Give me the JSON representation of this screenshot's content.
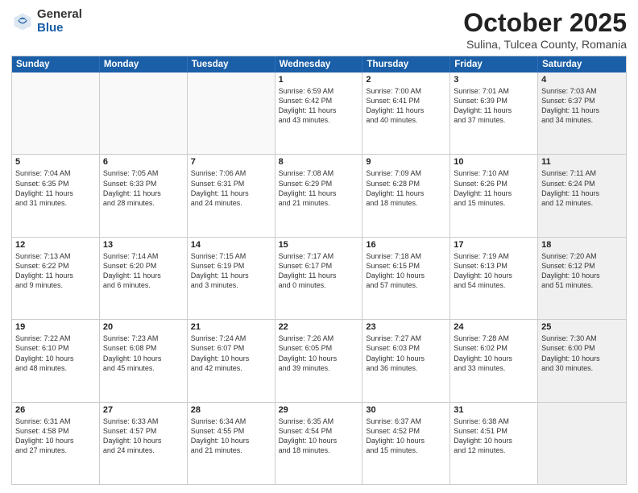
{
  "logo": {
    "general": "General",
    "blue": "Blue"
  },
  "title": {
    "month": "October 2025",
    "location": "Sulina, Tulcea County, Romania"
  },
  "header_days": [
    "Sunday",
    "Monday",
    "Tuesday",
    "Wednesday",
    "Thursday",
    "Friday",
    "Saturday"
  ],
  "rows": [
    [
      {
        "day": "",
        "lines": [],
        "empty": true
      },
      {
        "day": "",
        "lines": [],
        "empty": true
      },
      {
        "day": "",
        "lines": [],
        "empty": true
      },
      {
        "day": "1",
        "lines": [
          "Sunrise: 6:59 AM",
          "Sunset: 6:42 PM",
          "Daylight: 11 hours",
          "and 43 minutes."
        ],
        "empty": false
      },
      {
        "day": "2",
        "lines": [
          "Sunrise: 7:00 AM",
          "Sunset: 6:41 PM",
          "Daylight: 11 hours",
          "and 40 minutes."
        ],
        "empty": false
      },
      {
        "day": "3",
        "lines": [
          "Sunrise: 7:01 AM",
          "Sunset: 6:39 PM",
          "Daylight: 11 hours",
          "and 37 minutes."
        ],
        "empty": false
      },
      {
        "day": "4",
        "lines": [
          "Sunrise: 7:03 AM",
          "Sunset: 6:37 PM",
          "Daylight: 11 hours",
          "and 34 minutes."
        ],
        "empty": false,
        "shaded": true
      }
    ],
    [
      {
        "day": "5",
        "lines": [
          "Sunrise: 7:04 AM",
          "Sunset: 6:35 PM",
          "Daylight: 11 hours",
          "and 31 minutes."
        ],
        "empty": false
      },
      {
        "day": "6",
        "lines": [
          "Sunrise: 7:05 AM",
          "Sunset: 6:33 PM",
          "Daylight: 11 hours",
          "and 28 minutes."
        ],
        "empty": false
      },
      {
        "day": "7",
        "lines": [
          "Sunrise: 7:06 AM",
          "Sunset: 6:31 PM",
          "Daylight: 11 hours",
          "and 24 minutes."
        ],
        "empty": false
      },
      {
        "day": "8",
        "lines": [
          "Sunrise: 7:08 AM",
          "Sunset: 6:29 PM",
          "Daylight: 11 hours",
          "and 21 minutes."
        ],
        "empty": false
      },
      {
        "day": "9",
        "lines": [
          "Sunrise: 7:09 AM",
          "Sunset: 6:28 PM",
          "Daylight: 11 hours",
          "and 18 minutes."
        ],
        "empty": false
      },
      {
        "day": "10",
        "lines": [
          "Sunrise: 7:10 AM",
          "Sunset: 6:26 PM",
          "Daylight: 11 hours",
          "and 15 minutes."
        ],
        "empty": false
      },
      {
        "day": "11",
        "lines": [
          "Sunrise: 7:11 AM",
          "Sunset: 6:24 PM",
          "Daylight: 11 hours",
          "and 12 minutes."
        ],
        "empty": false,
        "shaded": true
      }
    ],
    [
      {
        "day": "12",
        "lines": [
          "Sunrise: 7:13 AM",
          "Sunset: 6:22 PM",
          "Daylight: 11 hours",
          "and 9 minutes."
        ],
        "empty": false
      },
      {
        "day": "13",
        "lines": [
          "Sunrise: 7:14 AM",
          "Sunset: 6:20 PM",
          "Daylight: 11 hours",
          "and 6 minutes."
        ],
        "empty": false
      },
      {
        "day": "14",
        "lines": [
          "Sunrise: 7:15 AM",
          "Sunset: 6:19 PM",
          "Daylight: 11 hours",
          "and 3 minutes."
        ],
        "empty": false
      },
      {
        "day": "15",
        "lines": [
          "Sunrise: 7:17 AM",
          "Sunset: 6:17 PM",
          "Daylight: 11 hours",
          "and 0 minutes."
        ],
        "empty": false
      },
      {
        "day": "16",
        "lines": [
          "Sunrise: 7:18 AM",
          "Sunset: 6:15 PM",
          "Daylight: 10 hours",
          "and 57 minutes."
        ],
        "empty": false
      },
      {
        "day": "17",
        "lines": [
          "Sunrise: 7:19 AM",
          "Sunset: 6:13 PM",
          "Daylight: 10 hours",
          "and 54 minutes."
        ],
        "empty": false
      },
      {
        "day": "18",
        "lines": [
          "Sunrise: 7:20 AM",
          "Sunset: 6:12 PM",
          "Daylight: 10 hours",
          "and 51 minutes."
        ],
        "empty": false,
        "shaded": true
      }
    ],
    [
      {
        "day": "19",
        "lines": [
          "Sunrise: 7:22 AM",
          "Sunset: 6:10 PM",
          "Daylight: 10 hours",
          "and 48 minutes."
        ],
        "empty": false
      },
      {
        "day": "20",
        "lines": [
          "Sunrise: 7:23 AM",
          "Sunset: 6:08 PM",
          "Daylight: 10 hours",
          "and 45 minutes."
        ],
        "empty": false
      },
      {
        "day": "21",
        "lines": [
          "Sunrise: 7:24 AM",
          "Sunset: 6:07 PM",
          "Daylight: 10 hours",
          "and 42 minutes."
        ],
        "empty": false
      },
      {
        "day": "22",
        "lines": [
          "Sunrise: 7:26 AM",
          "Sunset: 6:05 PM",
          "Daylight: 10 hours",
          "and 39 minutes."
        ],
        "empty": false
      },
      {
        "day": "23",
        "lines": [
          "Sunrise: 7:27 AM",
          "Sunset: 6:03 PM",
          "Daylight: 10 hours",
          "and 36 minutes."
        ],
        "empty": false
      },
      {
        "day": "24",
        "lines": [
          "Sunrise: 7:28 AM",
          "Sunset: 6:02 PM",
          "Daylight: 10 hours",
          "and 33 minutes."
        ],
        "empty": false
      },
      {
        "day": "25",
        "lines": [
          "Sunrise: 7:30 AM",
          "Sunset: 6:00 PM",
          "Daylight: 10 hours",
          "and 30 minutes."
        ],
        "empty": false,
        "shaded": true
      }
    ],
    [
      {
        "day": "26",
        "lines": [
          "Sunrise: 6:31 AM",
          "Sunset: 4:58 PM",
          "Daylight: 10 hours",
          "and 27 minutes."
        ],
        "empty": false
      },
      {
        "day": "27",
        "lines": [
          "Sunrise: 6:33 AM",
          "Sunset: 4:57 PM",
          "Daylight: 10 hours",
          "and 24 minutes."
        ],
        "empty": false
      },
      {
        "day": "28",
        "lines": [
          "Sunrise: 6:34 AM",
          "Sunset: 4:55 PM",
          "Daylight: 10 hours",
          "and 21 minutes."
        ],
        "empty": false
      },
      {
        "day": "29",
        "lines": [
          "Sunrise: 6:35 AM",
          "Sunset: 4:54 PM",
          "Daylight: 10 hours",
          "and 18 minutes."
        ],
        "empty": false
      },
      {
        "day": "30",
        "lines": [
          "Sunrise: 6:37 AM",
          "Sunset: 4:52 PM",
          "Daylight: 10 hours",
          "and 15 minutes."
        ],
        "empty": false
      },
      {
        "day": "31",
        "lines": [
          "Sunrise: 6:38 AM",
          "Sunset: 4:51 PM",
          "Daylight: 10 hours",
          "and 12 minutes."
        ],
        "empty": false
      },
      {
        "day": "",
        "lines": [],
        "empty": true,
        "shaded": true
      }
    ]
  ]
}
